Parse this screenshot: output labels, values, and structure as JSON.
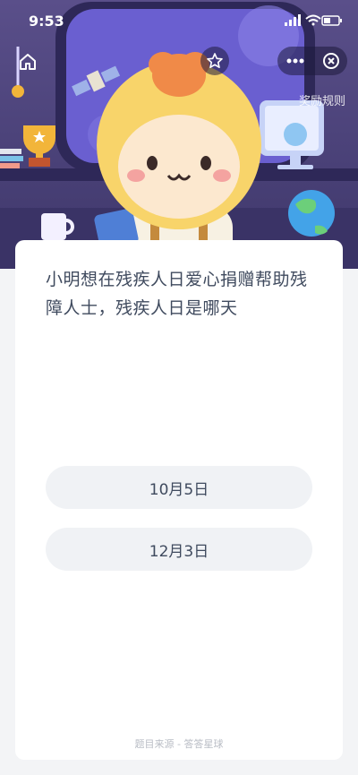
{
  "status_bar": {
    "time": "9:53"
  },
  "nav": {
    "home_icon": "home-icon",
    "star_icon": "star-icon",
    "more_icon": "more-dots-icon",
    "close_icon": "close-circle-icon",
    "rules_label": "奖励规则"
  },
  "quiz": {
    "question": "小明想在残疾人日爱心捐赠帮助残障人士，残疾人日是哪天",
    "options": [
      "10月5日",
      "12月3日"
    ]
  },
  "footer": {
    "source": "题目来源 - 答答星球"
  },
  "colors": {
    "hero_bg": "#4b4279",
    "card_bg": "#ffffff",
    "option_bg": "#f0f2f5",
    "text": "#3f4a5e"
  }
}
